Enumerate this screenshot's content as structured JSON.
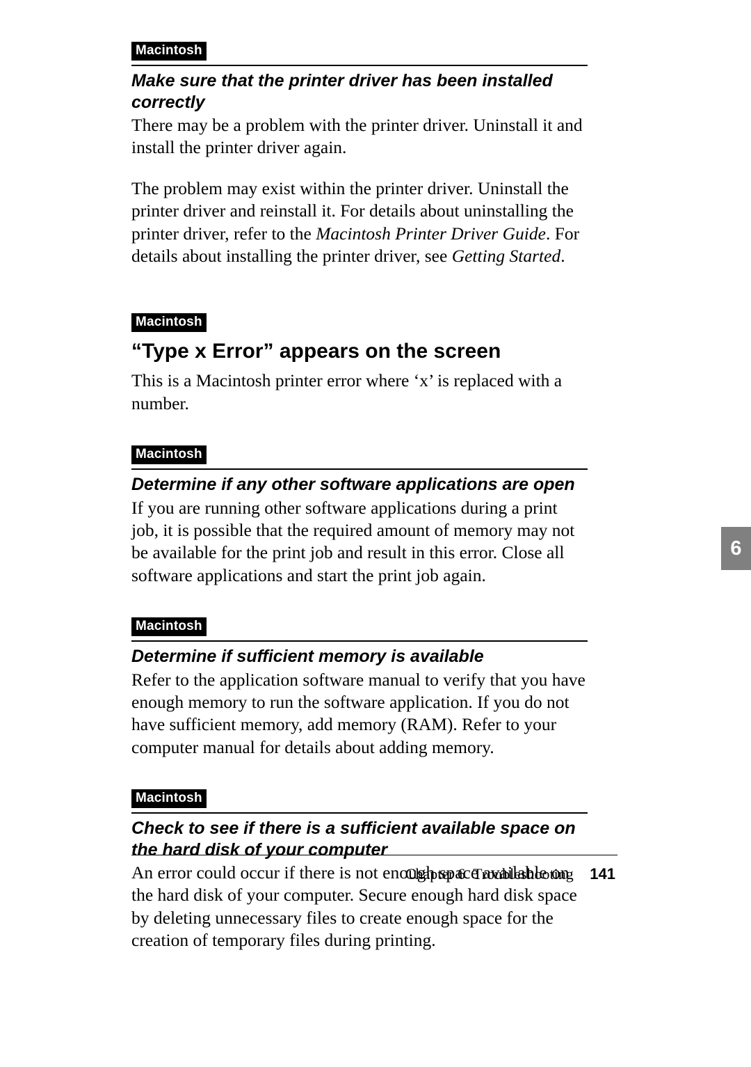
{
  "sections": [
    {
      "badge": "Macintosh",
      "hr": true,
      "subheading": "Make sure that the printer driver has been installed correctly",
      "paragraphs": [
        {
          "text": "There may be a problem with the printer driver. Uninstall it and install the printer driver again."
        },
        {
          "segments": [
            {
              "t": "The problem may exist within the printer driver.  Uninstall the printer driver and reinstall it. For details about uninstalling the printer driver, refer to the "
            },
            {
              "t": "Macintosh Printer Driver Guide",
              "i": true
            },
            {
              "t": ". For details about installing the printer driver, see "
            },
            {
              "t": "Getting Started",
              "i": true
            },
            {
              "t": "."
            }
          ]
        }
      ]
    },
    {
      "gap": "large",
      "badge": "Macintosh",
      "heading": "“Type x Error” appears on the screen",
      "paragraphs": [
        {
          "text": "This is a Macintosh printer error where ‘x’ is replaced with a number."
        }
      ]
    },
    {
      "gap": "small",
      "badge": "Macintosh",
      "hr": true,
      "subheading": "Determine if any other software applications are open",
      "paragraphs": [
        {
          "text": "If you are running other software applications during a print job, it is possible that the required amount of memory may not be available for the print job and result in this error.  Close all software applications and start the print job again."
        }
      ]
    },
    {
      "gap": "small",
      "badge": "Macintosh",
      "hr": true,
      "subheading": "Determine if sufficient memory is available",
      "paragraphs": [
        {
          "text": "Refer to the application software manual to verify that you have enough memory to run the software application. If you do not have sufficient memory, add memory (RAM).  Refer to your computer manual for details about adding memory."
        }
      ]
    },
    {
      "gap": "small",
      "badge": "Macintosh",
      "hr": true,
      "subheading": "Check to see if there is a sufficient available space on the hard disk of your computer",
      "paragraphs": [
        {
          "text": "An error could occur if there is not enough space available on the hard disk of your computer. Secure enough hard disk space by deleting unnecessary files to create enough space for the creation of temporary files during printing."
        }
      ]
    }
  ],
  "side_tab": "6",
  "footer": {
    "chapter": "Chapter 6",
    "title": "Troubleshooting",
    "page": "141"
  }
}
